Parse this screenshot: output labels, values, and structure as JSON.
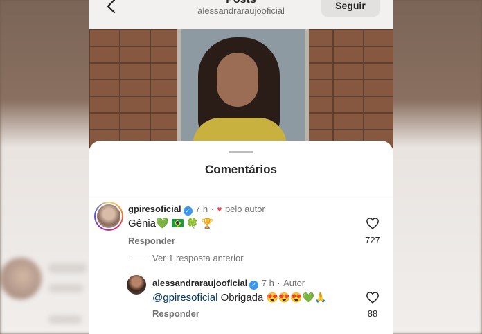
{
  "header": {
    "title": "Posts",
    "subtitle": "alessandraraujooficial",
    "follow_label": "Seguir"
  },
  "sheet": {
    "title": "Comentários"
  },
  "comments": [
    {
      "username": "gpiresoficial",
      "time": "7 h",
      "liked_by_author": "pelo autor",
      "text": "Gênia",
      "emojis": "💚 🍀 🏆",
      "reply_label": "Responder",
      "likes": "727"
    }
  ],
  "replies_toggle": "Ver 1 resposta anterior",
  "reply": {
    "username": "alessandraraujooficial",
    "time": "7 h",
    "author_badge": "Autor",
    "mention": "@gpiresoficial",
    "text": "Obrigada",
    "emojis": "😍😍😍💚🙏",
    "reply_label": "Responder",
    "likes": "88"
  },
  "colors": {
    "link": "#00376b",
    "verified": "#3897f0",
    "heart": "#ed4956"
  }
}
